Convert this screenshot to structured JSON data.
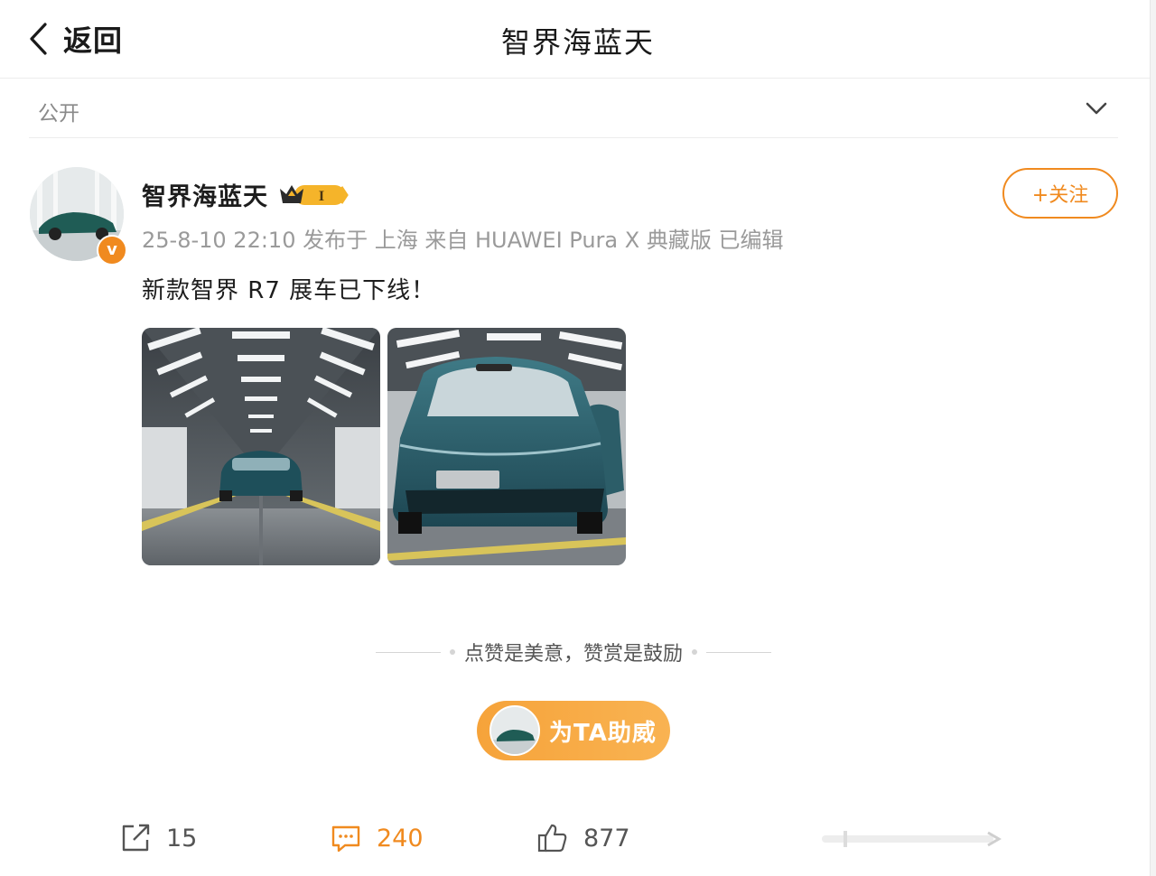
{
  "header": {
    "back_label": "返回",
    "title": "智界海蓝天"
  },
  "visibility": {
    "label": "公开"
  },
  "post": {
    "author": "智界海蓝天",
    "vip_level": "I",
    "meta": "25-8-10 22:10 发布于 上海 来自 HUAWEI Pura X 典藏版 已编辑",
    "follow_label": "+关注",
    "text": "新款智界 R7 展车已下线！",
    "photos": [
      "production-line-photo",
      "blue-car-front-photo"
    ]
  },
  "reward": {
    "slogan": "点赞是美意，赞赏是鼓励",
    "cheer_label": "为TA助威"
  },
  "actions": {
    "repost_count": "15",
    "comment_count": "240",
    "like_count": "877"
  },
  "colors": {
    "accent": "#f08a1f",
    "text_muted": "#9a9a9a"
  }
}
